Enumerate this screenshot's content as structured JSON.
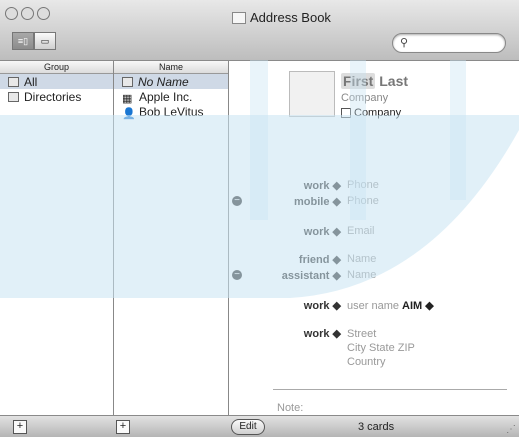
{
  "window": {
    "title": "Address Book"
  },
  "search": {
    "placeholder": ""
  },
  "columns": {
    "group_header": "Group",
    "name_header": "Name"
  },
  "groups": [
    {
      "label": "All",
      "selected": true
    },
    {
      "label": "Directories",
      "selected": false
    }
  ],
  "names": [
    {
      "label": "No Name",
      "selected": true
    },
    {
      "label": "Apple Inc.",
      "selected": false
    },
    {
      "label": "Bob LeVitus",
      "selected": false
    }
  ],
  "card": {
    "first": "First",
    "last": "Last",
    "company_placeholder": "Company",
    "company_checkbox": "Company",
    "fields": [
      {
        "label": "work",
        "value": "Phone"
      },
      {
        "label": "mobile",
        "value": "Phone"
      },
      {
        "label": "work",
        "value": "Email"
      },
      {
        "label": "friend",
        "value": "Name"
      },
      {
        "label": "assistant",
        "value": "Name"
      },
      {
        "label": "work",
        "value": "user name",
        "service": "AIM"
      },
      {
        "label": "work",
        "value": "Street",
        "line2": "City  State  ZIP",
        "line3": "Country"
      }
    ],
    "note_label": "Note:"
  },
  "footer": {
    "add_group": "+",
    "add_name": "+",
    "edit": "Edit",
    "card_count": "3 cards"
  },
  "colors": {
    "selection": "#cfd9e6",
    "watermark": "#c8e4f2"
  }
}
